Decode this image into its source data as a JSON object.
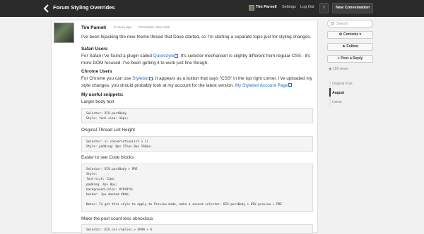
{
  "header": {
    "forum_title": "Forum Styling Overrides",
    "username": "Tim Parnell",
    "settings_label": "Settings",
    "logout_label": "Log Out",
    "notifications_count": "0",
    "new_conversation_label": "New Conversation"
  },
  "post": {
    "author": "Tim Parnell",
    "time": "5 hours ago",
    "location": "Rochester, New York",
    "intro": "I've been hijacking the new theme thread that Dave started, so I'm starting a separate topic just for styling changes.",
    "safari_heading": "Safari Users",
    "safari_text_1": "For Safari I've found a plugin called ",
    "safari_link": "Quickstyle",
    "safari_text_2": ". It's selector mechanism is slightly different from regular CSS - it's more DOM focused. I've been getting it to work just fine though.",
    "chrome_heading": "Chrome Users",
    "chrome_text_1": "For Chrome you can use ",
    "chrome_link": "Stylebot",
    "chrome_text_2": ". It appears as a button that says \"CSS\" in the top right corner. I've uploaded my style changes, you should probably look at my account for the latest version. ",
    "chrome_link_2": "My Stylebot Account Page",
    "chrome_text_3": ".",
    "snippets_heading": "My useful snippets:",
    "snippet1_label": "Larger body text",
    "snippet1_code": "Selector: DIV.postBody\nStyle: font-size: 14px;",
    "snippet2_label": "Original Thread List Height",
    "snippet2_code": "Selector: ul.conversationList > li\nStyle: padding: 8px 25lpx 8px 169px;",
    "snippet3_label": "Easier to see Code blocks",
    "snippet3_code": "Selector: DIV.postBody > PRE\nStyle:\nfont-size: 12px;\npadding: 4px 8px;\nbackground-color: #f8f8f8;\nborder: 1px dashed #bbb;\n\nNotes: To get this style to apply to Preview mode, make a second selector: DIV.postBody > DIV.preview > PRE",
    "snippet4_label": "Make the post count less obnoxious",
    "snippet4_code": "Selector: DIV.col-replies > SPAN > A"
  },
  "sidebar": {
    "search_placeholder": "Search",
    "controls_label": "Controls",
    "follow_label": "Follow",
    "post_reply_label": "Post a Reply",
    "views": "186 views",
    "timeline": [
      "Original Post",
      "August",
      "Latest"
    ]
  },
  "colors": {
    "topbar": "#2a2a2a",
    "link": "#2a6ebb"
  }
}
